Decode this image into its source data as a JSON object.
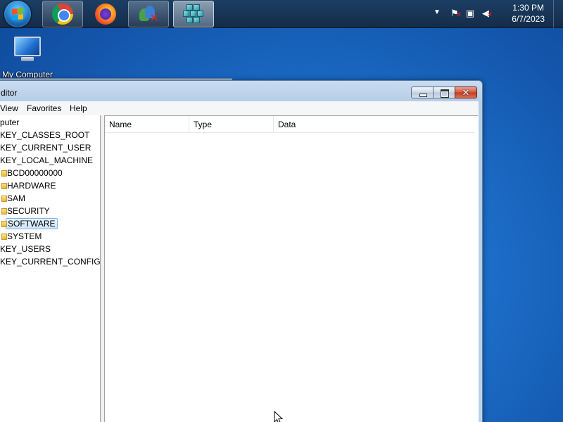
{
  "taskbar": {
    "buttons": [
      {
        "name": "start-button",
        "icon": "windows-logo-icon"
      },
      {
        "name": "chrome-taskbar-button",
        "icon": "chrome-icon"
      },
      {
        "name": "firefox-taskbar-button",
        "icon": "firefox-icon"
      },
      {
        "name": "users-taskbar-button",
        "icon": "users-icon"
      },
      {
        "name": "regedit-taskbar-button",
        "icon": "regedit-icon",
        "active": true
      }
    ],
    "tray": {
      "icons": [
        "show-hidden-icons-arrow",
        "action-center-flag-icon",
        "network-icon",
        "volume-muted-icon"
      ],
      "time": "1:30 PM",
      "date": "6/7/2023"
    }
  },
  "desktop": {
    "icons": [
      {
        "label": "My Computer",
        "icon": "my-computer-icon"
      }
    ]
  },
  "window": {
    "title": "ditor",
    "menu": [
      "View",
      "Favorites",
      "Help"
    ],
    "tree": {
      "root": "puter",
      "items": [
        {
          "label": "KEY_CLASSES_ROOT",
          "level": 1
        },
        {
          "label": "KEY_CURRENT_USER",
          "level": 1
        },
        {
          "label": "KEY_LOCAL_MACHINE",
          "level": 1
        },
        {
          "label": "BCD00000000",
          "level": 2
        },
        {
          "label": "HARDWARE",
          "level": 2
        },
        {
          "label": "SAM",
          "level": 2
        },
        {
          "label": "SECURITY",
          "level": 2
        },
        {
          "label": "SOFTWARE",
          "level": 2,
          "selected": true
        },
        {
          "label": "SYSTEM",
          "level": 2
        },
        {
          "label": "KEY_USERS",
          "level": 1
        },
        {
          "label": "KEY_CURRENT_CONFIG",
          "level": 1
        }
      ]
    },
    "list": {
      "columns": [
        "Name",
        "Type",
        "Data"
      ],
      "rows": []
    }
  },
  "colors": {
    "desktop": "#1c6ec8",
    "taskbar": "#1c3e63",
    "selection": "#cfe6fb",
    "close_button": "#c23c24"
  }
}
